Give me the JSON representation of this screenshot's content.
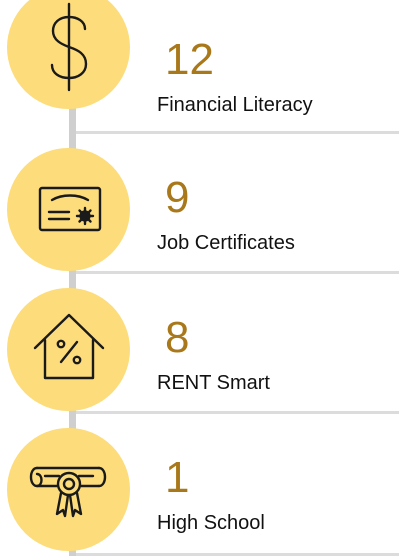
{
  "stats": [
    {
      "value": "12",
      "label": "Financial Literacy",
      "icon": "dollar-sign-icon"
    },
    {
      "value": "9",
      "label": "Job Certificates",
      "icon": "certificate-icon"
    },
    {
      "value": "8",
      "label": "RENT Smart",
      "icon": "house-percent-icon"
    },
    {
      "value": "1",
      "label": "High School",
      "icon": "diploma-icon"
    }
  ],
  "colors": {
    "circle": "#fddc7c",
    "value_text": "#a9781a",
    "label_text": "#111111",
    "timeline": "#cfcfcf",
    "divider": "#dcdcdc"
  }
}
